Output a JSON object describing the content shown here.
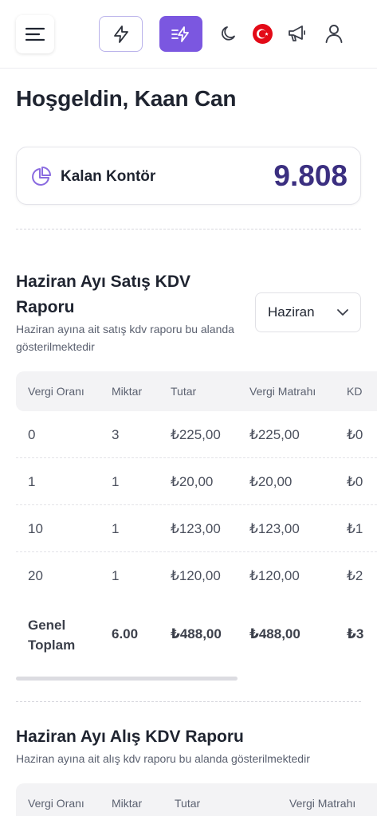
{
  "header": {
    "icons": [
      "menu-icon",
      "bolt-icon",
      "bolt-lines-icon",
      "moon-icon",
      "turkey-flag-icon",
      "megaphone-icon",
      "user-icon"
    ],
    "accent_color": "#7b57e0"
  },
  "greeting": "Hoşgeldin, Kaan Can",
  "balance": {
    "label": "Kalan Kontör",
    "value": "9.808",
    "icon": "pie-chart-icon",
    "value_color": "#3b2f80"
  },
  "sales_report": {
    "title": "Haziran Ayı Satış KDV Raporu",
    "subtitle": "Haziran ayına ait satış kdv raporu bu alanda gösterilmektedir",
    "month_select": {
      "value": "Haziran"
    },
    "columns": [
      "Vergi Oranı",
      "Miktar",
      "Tutar",
      "Vergi Matrahı",
      "KD"
    ],
    "rows": [
      [
        "0",
        "3",
        "₺225,00",
        "₺225,00",
        "₺0"
      ],
      [
        "1",
        "1",
        "₺20,00",
        "₺20,00",
        "₺0"
      ],
      [
        "10",
        "1",
        "₺123,00",
        "₺123,00",
        "₺1"
      ],
      [
        "20",
        "1",
        "₺120,00",
        "₺120,00",
        "₺2"
      ]
    ],
    "total": {
      "label": "Genel Toplam",
      "values": [
        "6.00",
        "₺488,00",
        "₺488,00",
        "₺3"
      ]
    }
  },
  "purchase_report": {
    "title": "Haziran Ayı Alış KDV Raporu",
    "subtitle": "Haziran ayına ait alış kdv raporu bu alanda gösterilmektedir",
    "columns": [
      "Vergi Oranı",
      "Miktar",
      "Tutar",
      "Vergi Matrahı"
    ]
  }
}
